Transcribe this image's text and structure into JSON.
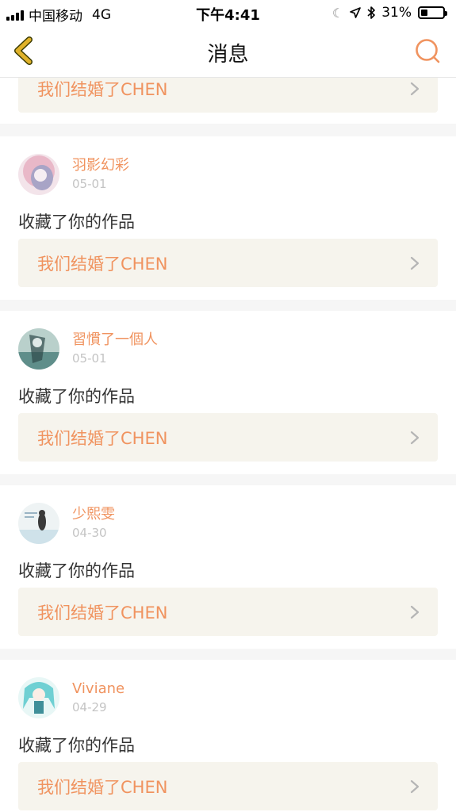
{
  "status_bar": {
    "carrier": "中国移动",
    "network": "4G",
    "time": "下午4:41",
    "battery": "31%",
    "battery_level": 0.31
  },
  "nav": {
    "title": "消息",
    "back_icon": "chevron-left-icon",
    "search_icon": "search-icon"
  },
  "colors": {
    "accent": "#f0935f",
    "back_icon": "#e0b22a",
    "card_bg": "#f6f4ed",
    "separator": "#f6f6f6"
  },
  "feed": {
    "partial_top": {
      "work_title": "我们结婚了CHEN"
    },
    "notifications": [
      {
        "user": "羽影幻彩",
        "date": "05-01",
        "action": "收藏了你的作品",
        "work_title": "我们结婚了CHEN",
        "avatar_colors": [
          "#e9b8c8",
          "#a8a4c6",
          "#f3e4ea"
        ]
      },
      {
        "user": "習慣了一個人",
        "date": "05-01",
        "action": "收藏了你的作品",
        "work_title": "我们结婚了CHEN",
        "avatar_colors": [
          "#5f8e8a",
          "#b9d0cb",
          "#2f4a4a"
        ]
      },
      {
        "user": "少熙雯",
        "date": "04-30",
        "action": "收藏了你的作品",
        "work_title": "我们结婚了CHEN",
        "avatar_colors": [
          "#cfe2ea",
          "#eef3f4",
          "#3a3a3a"
        ]
      },
      {
        "user": "Viviane",
        "date": "04-29",
        "action": "收藏了你的作品",
        "work_title": "我们结婚了CHEN",
        "avatar_colors": [
          "#6fd0d3",
          "#e8f7f6",
          "#3f8f99"
        ]
      }
    ]
  }
}
